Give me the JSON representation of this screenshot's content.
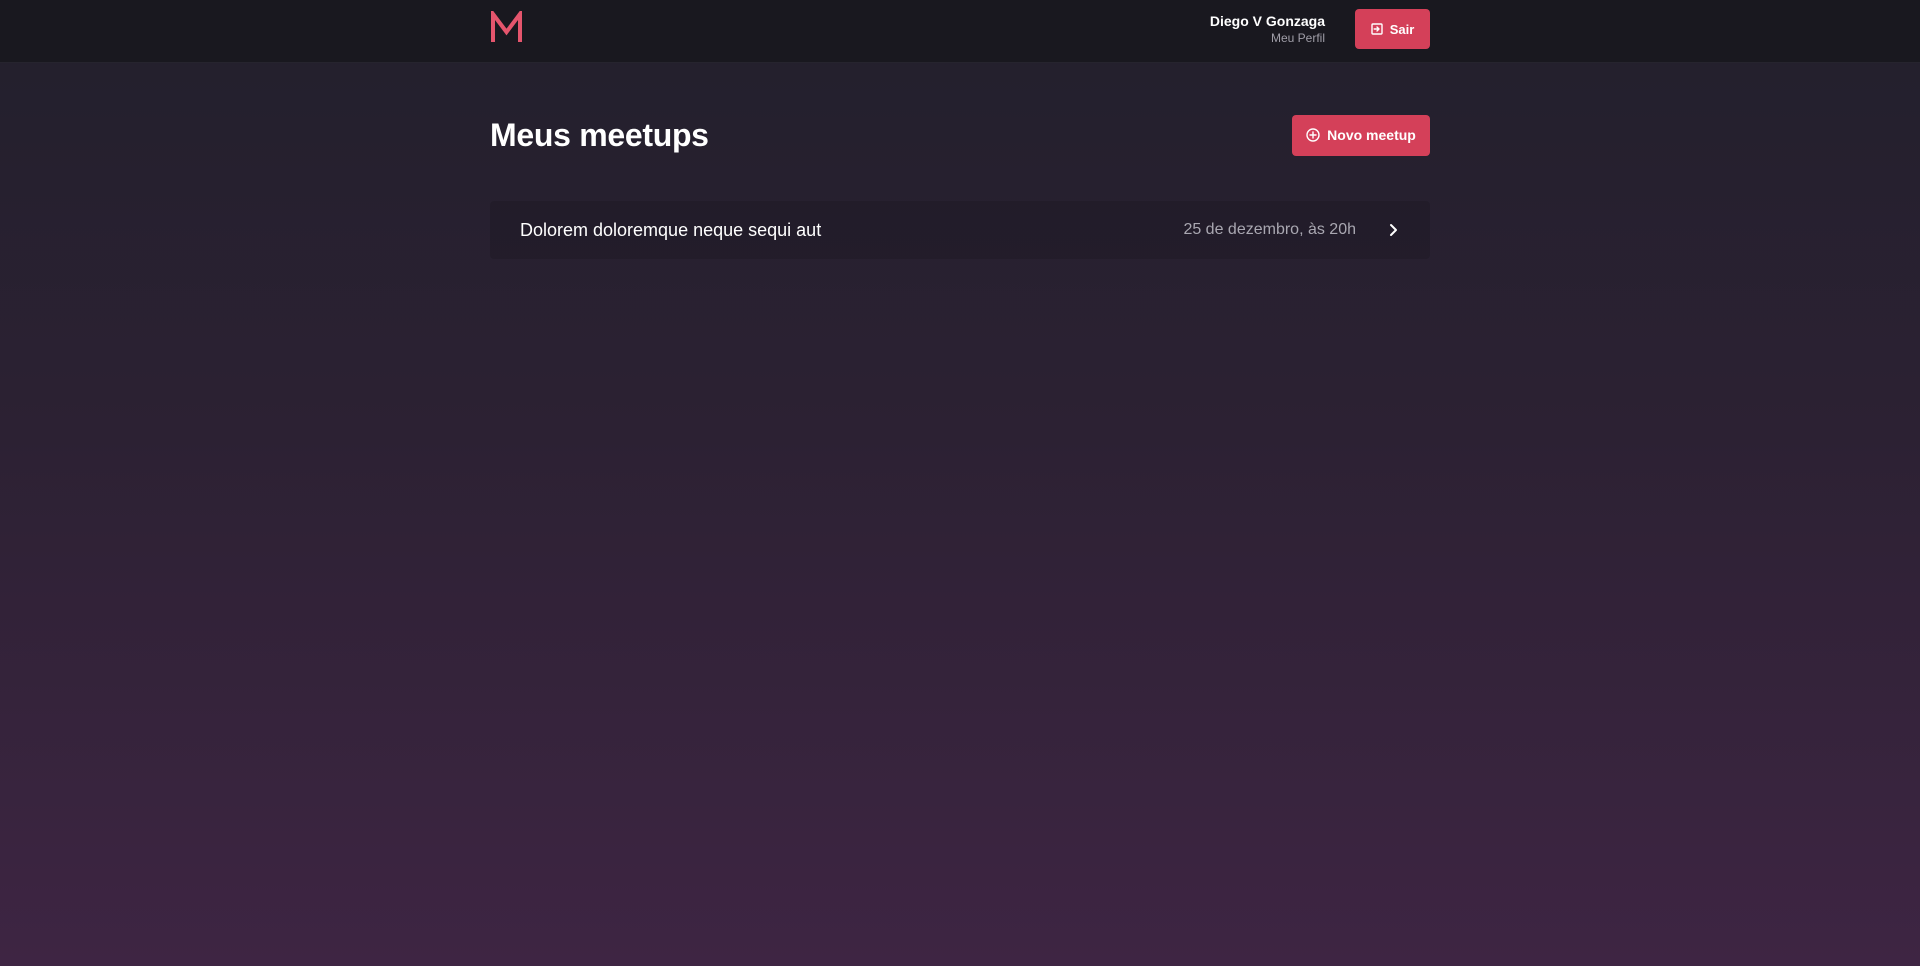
{
  "header": {
    "logo_icon": "meetapp-m-logo",
    "user_name": "Diego V Gonzaga",
    "profile_link": "Meu Perfil",
    "logout_label": "Sair",
    "logout_icon": "logout-icon"
  },
  "main": {
    "title": "Meus meetups",
    "new_button_label": "Novo meetup",
    "new_button_icon": "plus-circle-icon",
    "meetups": [
      {
        "title": "Dolorem doloremque neque sequi aut",
        "date": "25 de dezembro, às 20h"
      }
    ]
  },
  "colors": {
    "accent": "#d44059",
    "header_bg": "#19181f",
    "bg_top": "#22202c",
    "bg_bottom": "#3e2543",
    "muted_text": "#a9a7b1"
  }
}
